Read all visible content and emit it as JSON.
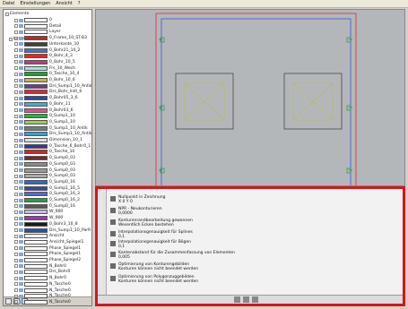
{
  "menu": [
    "Datei",
    "Einstellungen",
    "Ansicht",
    "?"
  ],
  "tree": {
    "root": "Elemente",
    "group_label": "Layer",
    "items": [
      {
        "label": "0",
        "color": "#ffffff"
      },
      {
        "label": "Detail",
        "color": "#ffffff"
      },
      {
        "label": "Layer",
        "color": "#ffffff"
      },
      {
        "label": "0_Frame_10_ST-B3",
        "color": "#b62c26"
      },
      {
        "label": "Unterkante_10",
        "color": "#404040"
      },
      {
        "label": "0_Bohr21_10_2",
        "color": "#3a78c2"
      },
      {
        "label": "0_Bohr_4_3",
        "color": "#ff2020"
      },
      {
        "label": "0_Bohr_10_5",
        "color": "#c23a86"
      },
      {
        "label": "Frs_10_Wech",
        "color": "#a8e0e0"
      },
      {
        "label": "0_Tasche_10_4",
        "color": "#1f9e3c"
      },
      {
        "label": "0_Bohr_10_6",
        "color": "#c9b04a"
      },
      {
        "label": "Drs_Sump1_10_AnfahrTa",
        "color": "#6a3aa2"
      },
      {
        "label": "Drs_Bohr_Initl_6",
        "color": "#d13030"
      },
      {
        "label": "0_Bohr05_3_6",
        "color": "#2c4a9e"
      },
      {
        "label": "0_Bohr_11",
        "color": "#3ab0d8"
      },
      {
        "label": "0_Bohr03_6",
        "color": "#e84c8c"
      },
      {
        "label": "0_Sump1_10",
        "color": "#2ab046"
      },
      {
        "label": "0_Sump1_10",
        "color": "#9acb5a"
      },
      {
        "label": "0_Sump1_10_Antik",
        "color": "#7a7a7a"
      },
      {
        "label": "Drs_Sump1_10_Antik",
        "color": "#38a0d0"
      },
      {
        "label": "Dimension_10_1",
        "color": "#dedede"
      },
      {
        "label": "0_Tasche_6_Bohr0_1",
        "color": "#2c3c9e"
      },
      {
        "label": "0_Tasche_10",
        "color": "#c82a2a"
      },
      {
        "label": "0_Sump0_03",
        "color": "#7a2a2a"
      },
      {
        "label": "0_Sump0_03",
        "color": "#8a8a8a"
      },
      {
        "label": "0_Sump0_03",
        "color": "#9a9a9a"
      },
      {
        "label": "0_Sump0_03",
        "color": "#aaaaaa"
      },
      {
        "label": "0_Sump0_16",
        "color": "#2a6cc8"
      },
      {
        "label": "0_Sump1_16_5",
        "color": "#3c46a8"
      },
      {
        "label": "0_Sump0_16_3",
        "color": "#5a6ac8"
      },
      {
        "label": "0_Sump0_16_2",
        "color": "#2aa03c"
      },
      {
        "label": "0_Sump0_16",
        "color": "#5a5a5a"
      },
      {
        "label": "W_900",
        "color": "#c8b8e8"
      },
      {
        "label": "W_900",
        "color": "#9a3ab0"
      },
      {
        "label": "0_Bohr3_10_8",
        "color": "#1a1a1a"
      },
      {
        "label": "Drs_Sump1_10_ParR",
        "color": "#2850b0"
      },
      {
        "label": "Ansicht",
        "color": "#ffffff"
      },
      {
        "label": "Ansicht_Spiegel1",
        "color": "#ffffff"
      },
      {
        "label": "Phase_Spiegel1",
        "color": "#ffffff"
      },
      {
        "label": "Phase_Spiegel1",
        "color": "#ffffff"
      },
      {
        "label": "Phase_Spiegel2",
        "color": "#ffffff"
      },
      {
        "label": "N_Bohr0",
        "color": "#ffffff"
      },
      {
        "label": "Drs_Bohr0",
        "color": "#ffffff"
      },
      {
        "label": "N_Bohr0",
        "color": "#ffffff"
      },
      {
        "label": "N_Tasche0",
        "color": "#ffffff"
      },
      {
        "label": "N_Tasche0",
        "color": "#ffffff"
      },
      {
        "label": "N_Tasche0",
        "color": "#ffffff"
      },
      {
        "label": "N_Tasche0",
        "color": "#ffffff"
      }
    ]
  },
  "messages": [
    {
      "title": "Nullpunkt in Zeichnung",
      "detail": "X 0   Y 0"
    },
    {
      "title": "NPR - Neukonturieren",
      "detail": "0,0000"
    },
    {
      "title": "Konturenrandbearbeitung gewonnen",
      "detail": "Wesentlich Ecken bestehen"
    },
    {
      "title": "Interpolationsgenauigkeit für Splines",
      "detail": "0,1"
    },
    {
      "title": "Interpolationsgenauigkeit für Bögen",
      "detail": "0,1"
    },
    {
      "title": "Kantenabstand für die Zusammenfassung von Elementen",
      "detail": "0,005"
    },
    {
      "title": "Optimierung von Konturengebilden",
      "detail": "Konturen können nicht beendet werden"
    },
    {
      "title": "Optimierung von Polygonzuggebilden",
      "detail": "Konturen können nicht beendet werden"
    }
  ],
  "colors": {
    "accent": "#d8141a",
    "canvas": "#b4b7ba"
  }
}
